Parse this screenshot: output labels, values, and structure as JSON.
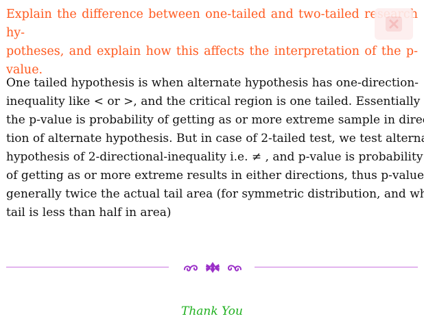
{
  "question": {
    "lines": [
      "Explain the difference between one-tailed and two-tailed research hy-",
      "potheses, and explain how this affects the interpretation of the p-value."
    ]
  },
  "answer": {
    "lines": [
      "One tailed hypothesis is when alternate hypothesis has one-direction-",
      "inequality like < or >, and the critical region is one tailed.  Essentially",
      "the p-value is probability of getting as or more extreme sample in direc-",
      "tion of alternate hypothesis.  But in case of 2-tailed test, we test alternate",
      "hypothesis of 2-directional-inequality i.e.  ≠ , and p-value is probability",
      "of getting as or more extreme results in either directions, thus p-value is",
      "generally twice the actual tail area (for symmetric distribution, and when",
      "tail is less than half in area)"
    ]
  },
  "footer": {
    "thanks": "Thank You"
  },
  "colors": {
    "question": "#ff5a1f",
    "divider": "#c974e0",
    "ornament": "#9b30c8",
    "thanks": "#1fb01f"
  },
  "icons": {
    "badge": "watermark-badge-icon",
    "ornament": "floral-ornament-icon"
  }
}
